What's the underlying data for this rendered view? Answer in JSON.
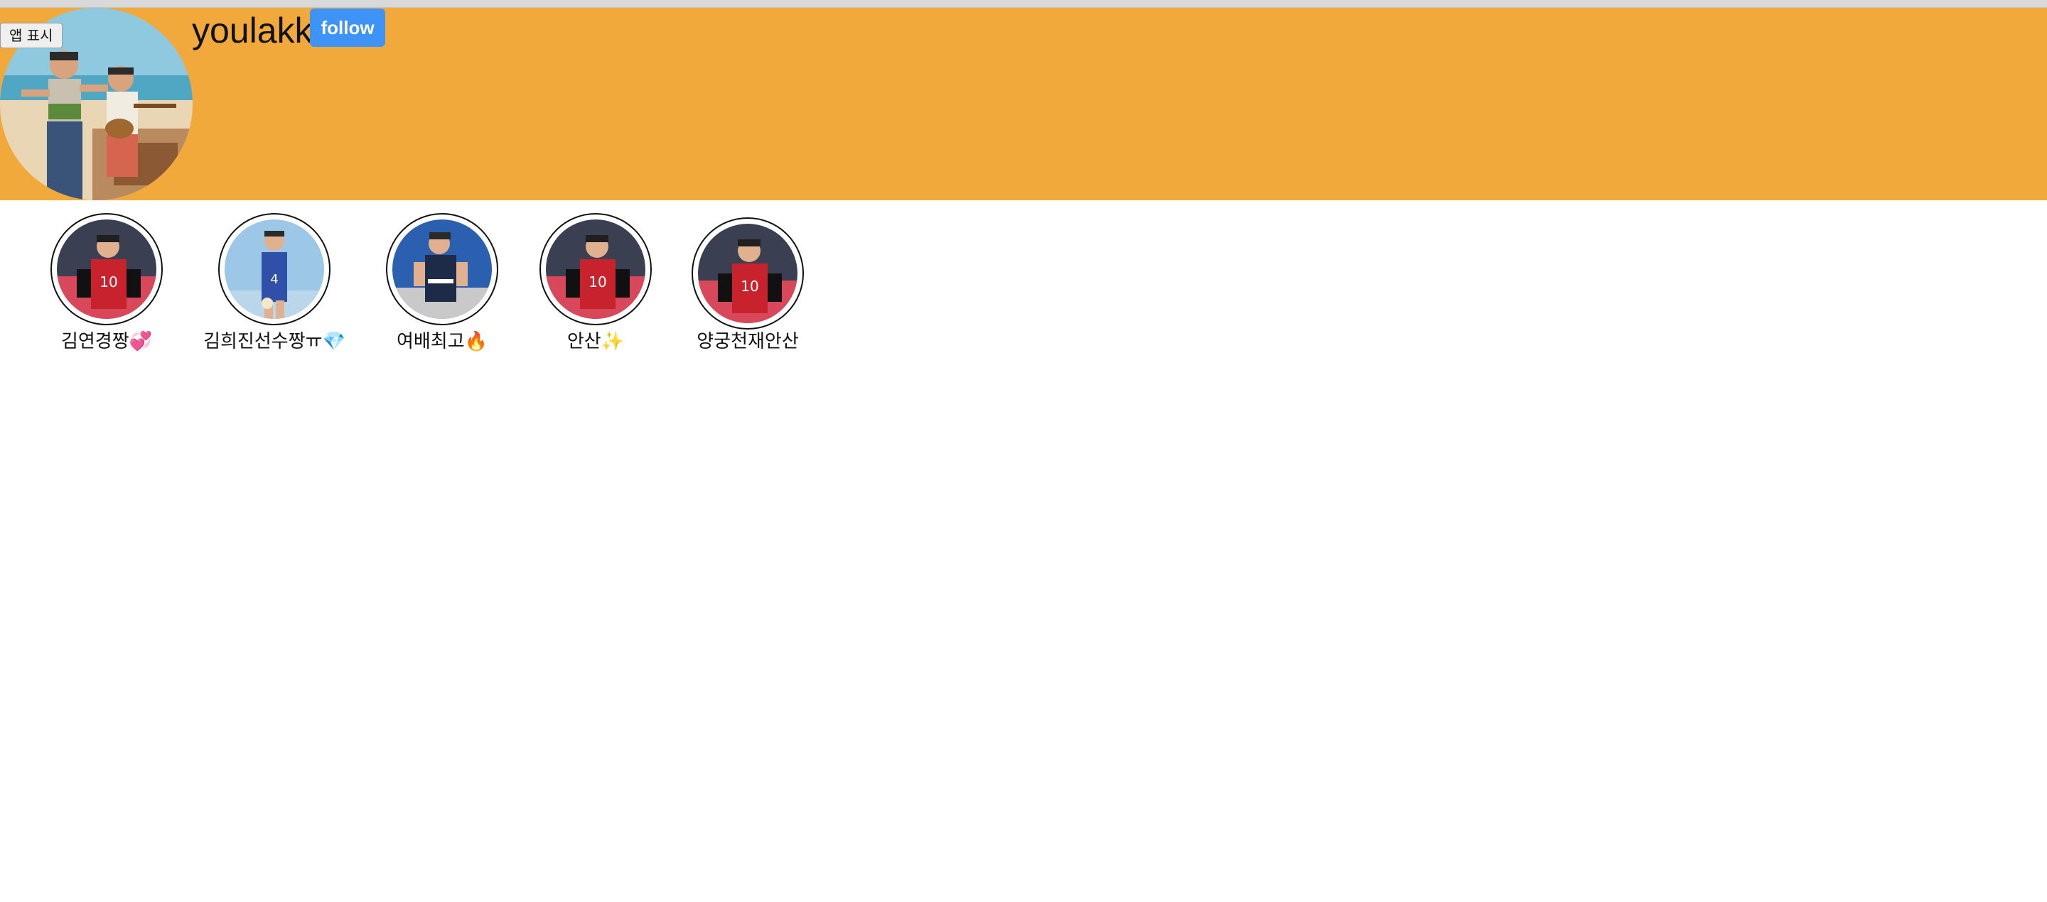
{
  "app_button_label": "앱 표시",
  "profile": {
    "username": "youlakk",
    "follow_label": "follow",
    "avatar_icon": "profile-photo-two-people-beach"
  },
  "colors": {
    "header_bg": "#f2a93b",
    "follow_bg": "#3d94f6"
  },
  "highlights": [
    {
      "label": "김연경짱💞",
      "thumb": "volleyball-player-red-jersey-10"
    },
    {
      "label": "김희진선수짱ㅠ💎",
      "thumb": "volleyball-player-blue-jersey-4"
    },
    {
      "label": "여배최고🔥",
      "thumb": "volleyball-player-navy-jersey"
    },
    {
      "label": "안산✨",
      "thumb": "volleyball-player-red-jersey-10"
    },
    {
      "label": "양궁천재안산",
      "thumb": "volleyball-player-red-jersey-10"
    }
  ]
}
